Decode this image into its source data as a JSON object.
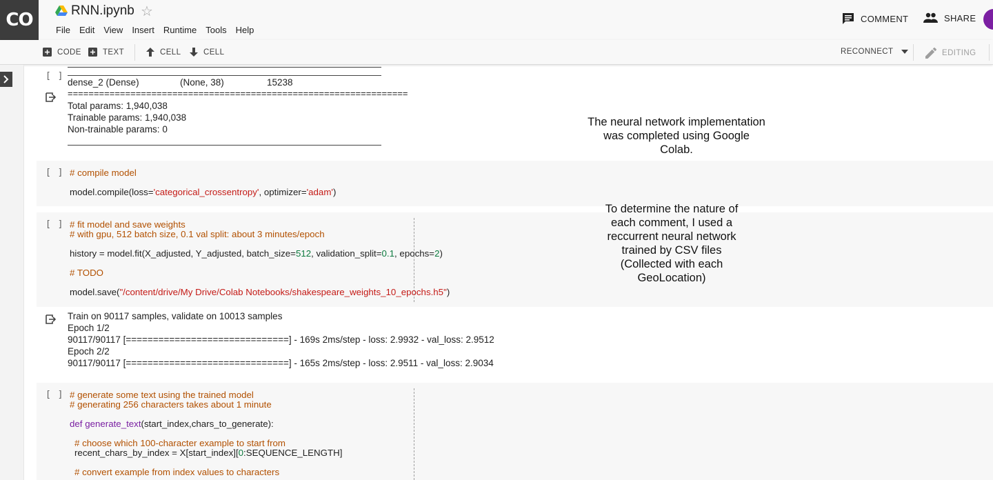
{
  "app": {
    "logo": "CO",
    "title": "RNN.ipynb",
    "star": "☆"
  },
  "menu": [
    "File",
    "Edit",
    "View",
    "Insert",
    "Runtime",
    "Tools",
    "Help"
  ],
  "header_actions": {
    "comment": "COMMENT",
    "share": "SHARE"
  },
  "toolbar": {
    "add_code": "CODE",
    "add_text": "TEXT",
    "cell_up": "CELL",
    "cell_down": "CELL",
    "reconnect": "RECONNECT",
    "editing": "EDITING"
  },
  "cells": {
    "bracket": "[ ]",
    "summary": {
      "dense_name": "dense_2 (Dense)",
      "dense_shape": "(None, 38)",
      "dense_params": "15238",
      "equals": "=================================================================",
      "total": "Total params: 1,940,038",
      "trainable": "Trainable params: 1,940,038",
      "non_trainable": "Non-trainable params: 0"
    },
    "compile": {
      "comment": "# compile model",
      "line_a": "model.compile(loss=",
      "line_str1": "'categorical_crossentropy'",
      "line_b": ", optimizer=",
      "line_str2": "'adam'",
      "line_c": ")"
    },
    "fit": {
      "comment1": "# fit model and save weights",
      "comment2": "# with gpu, 512 batch size, 0.1 val split: about 3 minutes/epoch",
      "hist_a": "history = model.fit(X_adjusted, Y_adjusted, batch_size=",
      "hist_n1": "512",
      "hist_b": ", validation_split=",
      "hist_n2": "0.1",
      "hist_c": ", epochs=",
      "hist_n3": "2",
      "hist_d": ")",
      "todo": "# TODO",
      "save_a": "model.save(",
      "save_str": "\"/content/drive/My Drive/Colab Notebooks/shakespeare_weights_10_epochs.h5\"",
      "save_b": ")"
    },
    "train_output": [
      "Train on 90117 samples, validate on 10013 samples",
      "Epoch 1/2",
      "90117/90117 [==============================] - 169s 2ms/step - loss: 2.9932 - val_loss: 2.9512",
      "Epoch 2/2",
      "90117/90117 [==============================] - 165s 2ms/step - loss: 2.9511 - val_loss: 2.9034"
    ],
    "generate": {
      "comment1": "# generate some text using the trained model",
      "comment2": "# generating 256 characters takes about 1 minute",
      "def_kw": "def",
      "def_name": "generate_text",
      "def_args": "(start_index,chars_to_generate):",
      "comment3": "# choose which 100-character example to start from",
      "recent_a": "recent_chars_by_index = X[start_index][",
      "recent_n": "0",
      "recent_b": ":SEQUENCE_LENGTH]",
      "comment4": "# convert example from index values to characters"
    }
  },
  "notes": {
    "note1": "The neural network implementation\nwas completed using Google\nColab.",
    "note2": "To determine the nature of\neach comment, I used a\nreccurrent neural network\ntrained by CSV files\n(Collected with each\nGeoLocation)"
  }
}
